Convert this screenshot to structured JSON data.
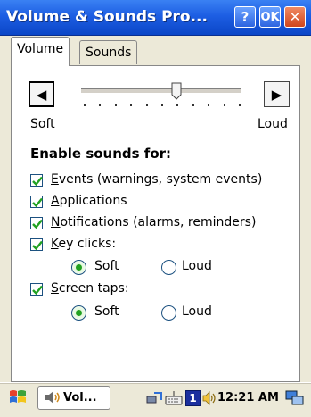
{
  "window": {
    "title": "Volume & Sounds Pro...",
    "help_label": "?",
    "ok_label": "OK",
    "close_label": "✕"
  },
  "tabs": [
    {
      "label": "Volume",
      "selected": true
    },
    {
      "label": "Sounds",
      "selected": false
    }
  ],
  "volume": {
    "decrease_glyph": "◀",
    "increase_glyph": "▶",
    "level_fraction": 0.6,
    "min_label": "Soft",
    "max_label": "Loud"
  },
  "sounds": {
    "heading": "Enable sounds for:",
    "options": [
      {
        "label": "Events (warnings, system events)",
        "checked": true
      },
      {
        "label": "Applications",
        "checked": true
      },
      {
        "label": "Notifications (alarms, reminders)",
        "checked": true
      },
      {
        "label": "Key clicks:",
        "checked": true
      },
      {
        "label": "Screen taps:",
        "checked": true
      }
    ],
    "key_clicks": {
      "soft_label": "Soft",
      "loud_label": "Loud",
      "selected": "Soft"
    },
    "screen_taps": {
      "soft_label": "Soft",
      "loud_label": "Loud",
      "selected": "Soft"
    }
  },
  "taskbar": {
    "start_icon": "windows-flag-icon",
    "task_button_label": "Vol...",
    "tray_icons": [
      "connectivity-icon",
      "keyboard-icon",
      "input-indicator-icon",
      "volume-icon"
    ],
    "input_indicator_text": "1",
    "clock": "12:21 AM",
    "desktop_icon": "show-desktop-icon"
  },
  "colors": {
    "title_bar": "#1d5ee3",
    "check_green": "#21a121",
    "close_red": "#d0451c"
  }
}
